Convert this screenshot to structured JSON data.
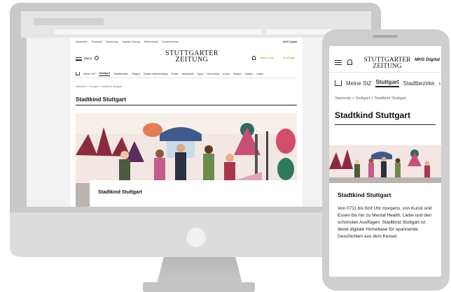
{
  "desktop": {
    "topnav": [
      "Newsletter",
      "Podcasts",
      "Meine App",
      "Digitale Zeitung",
      "Stellenmarkt",
      "Sonderthemen"
    ],
    "mhs_label": "MHS Digital",
    "menu_label": "Menü",
    "logo_line1": "STUTTGARTER",
    "logo_line2": "ZEITUNG",
    "login_label": "Mein Konto",
    "abo_label": "Abo/Login",
    "secnav": [
      "Meine StZ",
      "Stuttgart",
      "Stadtbezirke",
      "Region",
      "Baden-Württemberg",
      "Politik",
      "Wirtschaft",
      "Sport",
      "Panorama",
      "Kultur",
      "Reisen",
      "Rätsel",
      "Leben"
    ],
    "secnav_active": "Stuttgart",
    "breadcrumb": "Startseite > Stuttgart > Stadtkind Stuttgart",
    "section_title": "Stadtkind Stuttgart",
    "caption_title": "Stadtkind Stuttgart"
  },
  "phone": {
    "logo_line1": "STUTTGARTER",
    "logo_line2": "ZEITUNG",
    "mhs_label": "MHS Digital",
    "nav": [
      "Meine StZ",
      "Stuttgart",
      "Stadtbezirke"
    ],
    "nav_active": "Stuttgart",
    "breadcrumb": "Startseite  >  Stuttgart  >  Stadtkind Stuttgart",
    "title": "Stadtkind Stuttgart",
    "card_title": "Stadtkind Stuttgart",
    "card_text": "Von 0711 bis fünf Uhr morgens, von Kunst und Essen bis hin zu Mental Health, Liebe und den schönsten Ausflügen: Stadtkind Stuttgart ist deine digitale Homebase für spannende Geschichten aus dem Kessel."
  },
  "colors": {
    "accent_gold": "#b08a00",
    "device_gray": "#cfcfcf"
  }
}
